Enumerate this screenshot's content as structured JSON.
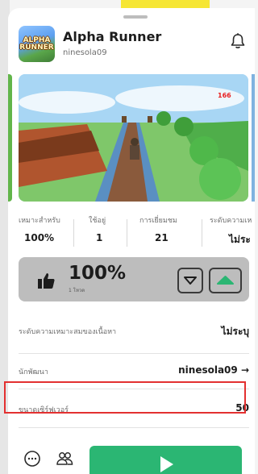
{
  "game": {
    "title": "Alpha Runner",
    "creator": "ninesola09",
    "thumbnail_text_line1": "ALPHA",
    "thumbnail_text_line2": "RUNNER",
    "screenshot_counter": "166"
  },
  "stats": [
    {
      "label": "เหมาะสำหรับ",
      "value": "100%"
    },
    {
      "label": "ใช้อยู่",
      "value": "1"
    },
    {
      "label": "การเยี่ยมชม",
      "value": "21"
    },
    {
      "label": "ระดับความเห",
      "value": "ไม่ระ"
    }
  ],
  "rating": {
    "percent": "100%",
    "votes": "1 โหวต"
  },
  "details": {
    "maturity_label": "ระดับความเหมาะสมของเนื้อหา",
    "maturity_value": "ไม่ระบุ",
    "developer_label": "นักพัฒนา",
    "developer_value": "ninesola09 →",
    "server_size_label": "ขนาดเซิร์ฟเวอร์",
    "server_size_value": "50"
  },
  "colors": {
    "play_button": "#2bb673",
    "highlight": "#e33030",
    "vote_box": "#bdbdbd"
  },
  "icons": [
    "bell-icon",
    "thumbs-up-icon",
    "thumb-down-triangle-icon",
    "thumb-up-triangle-icon",
    "more-icon",
    "party-icon",
    "play-icon"
  ]
}
